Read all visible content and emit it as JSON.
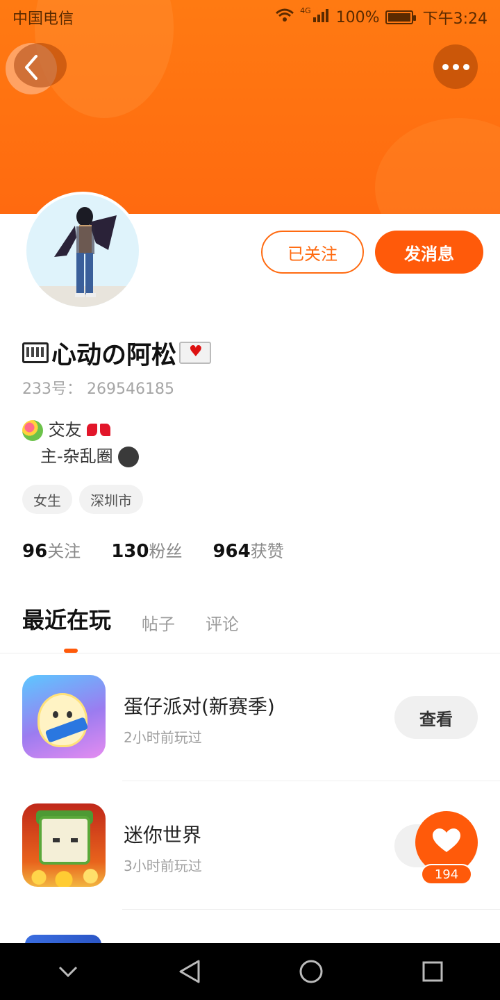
{
  "status_bar": {
    "carrier": "中国电信",
    "network": "4G",
    "battery": "100%",
    "time": "下午3:24"
  },
  "header": {
    "back_icon": "back-chevron-icon",
    "more_icon": "more-dots-icon"
  },
  "profile": {
    "follow_button": "已关注",
    "message_button": "发消息",
    "username": "心动の阿松",
    "uid_label": "233号：",
    "uid_value": "269546185",
    "bio_line1": "交友",
    "bio_line2": "主-杂乱圈",
    "tags": [
      "女生",
      "深圳市"
    ],
    "stats": [
      {
        "num": "96",
        "label": "关注"
      },
      {
        "num": "130",
        "label": "粉丝"
      },
      {
        "num": "964",
        "label": "获赞"
      }
    ]
  },
  "tabs": [
    {
      "label": "最近在玩",
      "active": true
    },
    {
      "label": "帖子",
      "active": false
    },
    {
      "label": "评论",
      "active": false
    }
  ],
  "games": [
    {
      "name": "蛋仔派对(新赛季)",
      "time": "2小时前玩过",
      "button": "查看"
    },
    {
      "name": "迷你世界",
      "time": "3小时前玩过",
      "button": "查看"
    }
  ],
  "like_fab": {
    "count": "194"
  },
  "colors": {
    "accent": "#ff5a0a",
    "banner": "#ff7a12"
  }
}
